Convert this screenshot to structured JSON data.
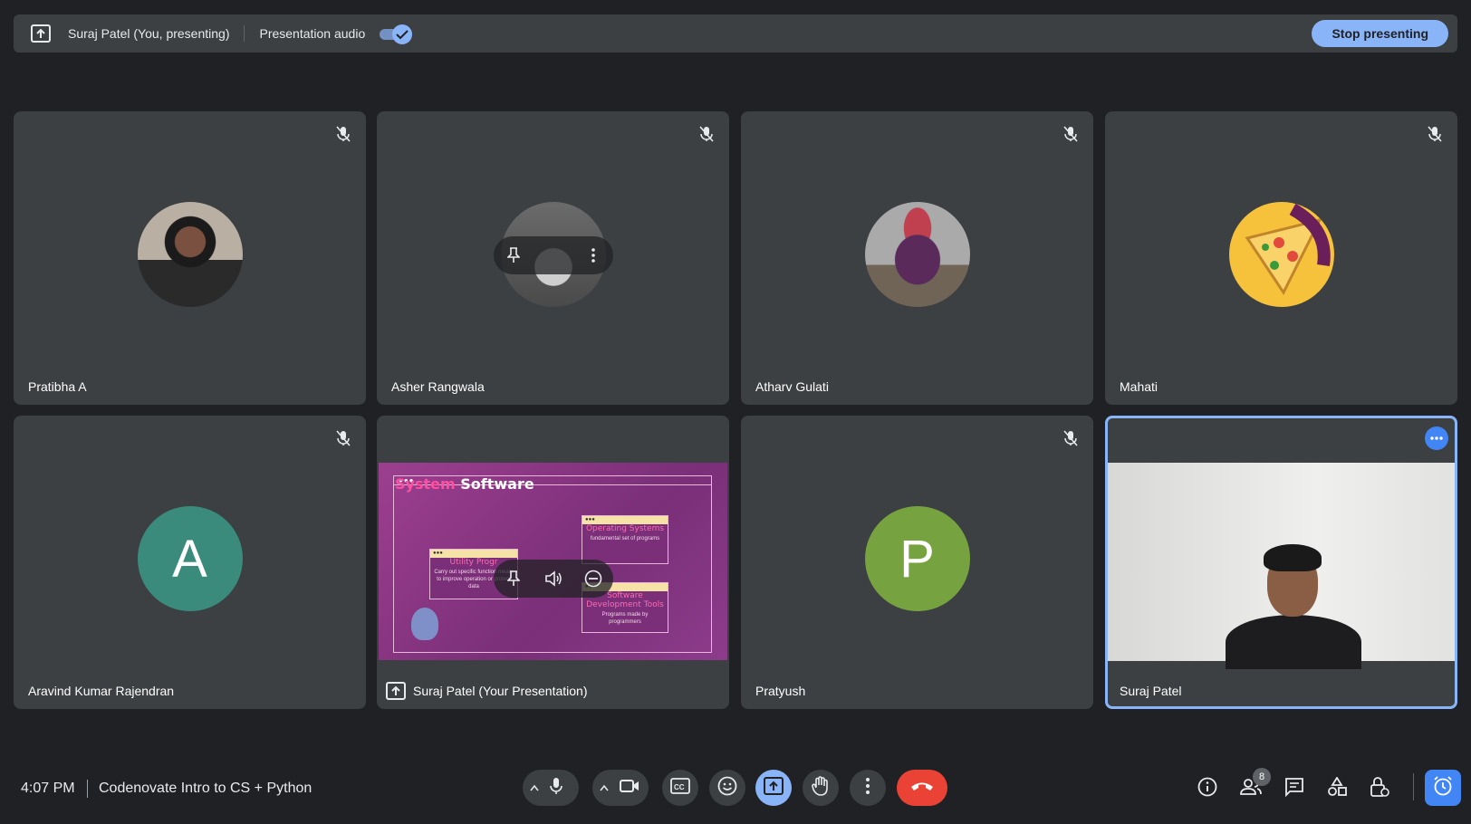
{
  "topbar": {
    "presenter_label": "Suraj Patel (You, presenting)",
    "audio_label": "Presentation audio",
    "stop_label": "Stop presenting"
  },
  "tiles": [
    {
      "name": "Pratibha A",
      "avatar": "photo"
    },
    {
      "name": "Asher Rangwala",
      "avatar": "photo"
    },
    {
      "name": "Atharv Gulati",
      "avatar": "photo"
    },
    {
      "name": "Mahati",
      "avatar": "photo"
    },
    {
      "name": "Aravind Kumar Rajendran",
      "letter": "A",
      "color": "#3a8b7c"
    },
    {
      "name": "Suraj Patel (Your Presentation)",
      "avatar": "presentation"
    },
    {
      "name": "Pratyush",
      "letter": "P",
      "color": "#76a33f"
    },
    {
      "name": "Suraj Patel",
      "avatar": "video"
    }
  ],
  "slide": {
    "title_part1": "System",
    "title_part2": "Software",
    "utility_title": "Utility Progr",
    "utility_text": "Carry out specific function meant to improve operation or protect data",
    "os_title": "Operating Systems",
    "os_text": "fundamental set of programs",
    "sdt_title": "Software Development Tools",
    "sdt_text": "Programs made by programmers"
  },
  "bottombar": {
    "time": "4:07 PM",
    "meeting_title": "Codenovate Intro to CS + Python",
    "participants_count": "8"
  },
  "colors": {
    "accent": "#8ab4f8",
    "end_call": "#ea4335",
    "tile_bg": "#3c4043"
  }
}
